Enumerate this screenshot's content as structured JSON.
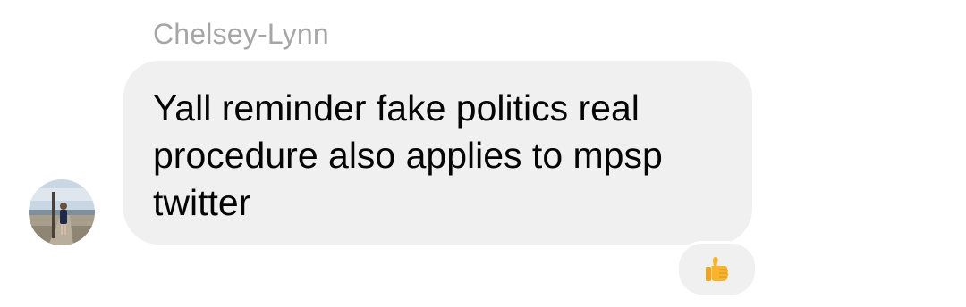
{
  "message": {
    "sender_name": "Chelsey-Lynn",
    "text": "Yall reminder fake politics real\nprocedure also applies to mpsp\ntwitter",
    "avatar_icon": "profile-photo",
    "reaction": {
      "icon": "thumbs-up-icon",
      "count": 1
    }
  },
  "colors": {
    "bubble": "#f0f0f0",
    "sender_name": "#a6a6a6",
    "text": "#050505",
    "reaction_emoji": "#f7b42c"
  }
}
